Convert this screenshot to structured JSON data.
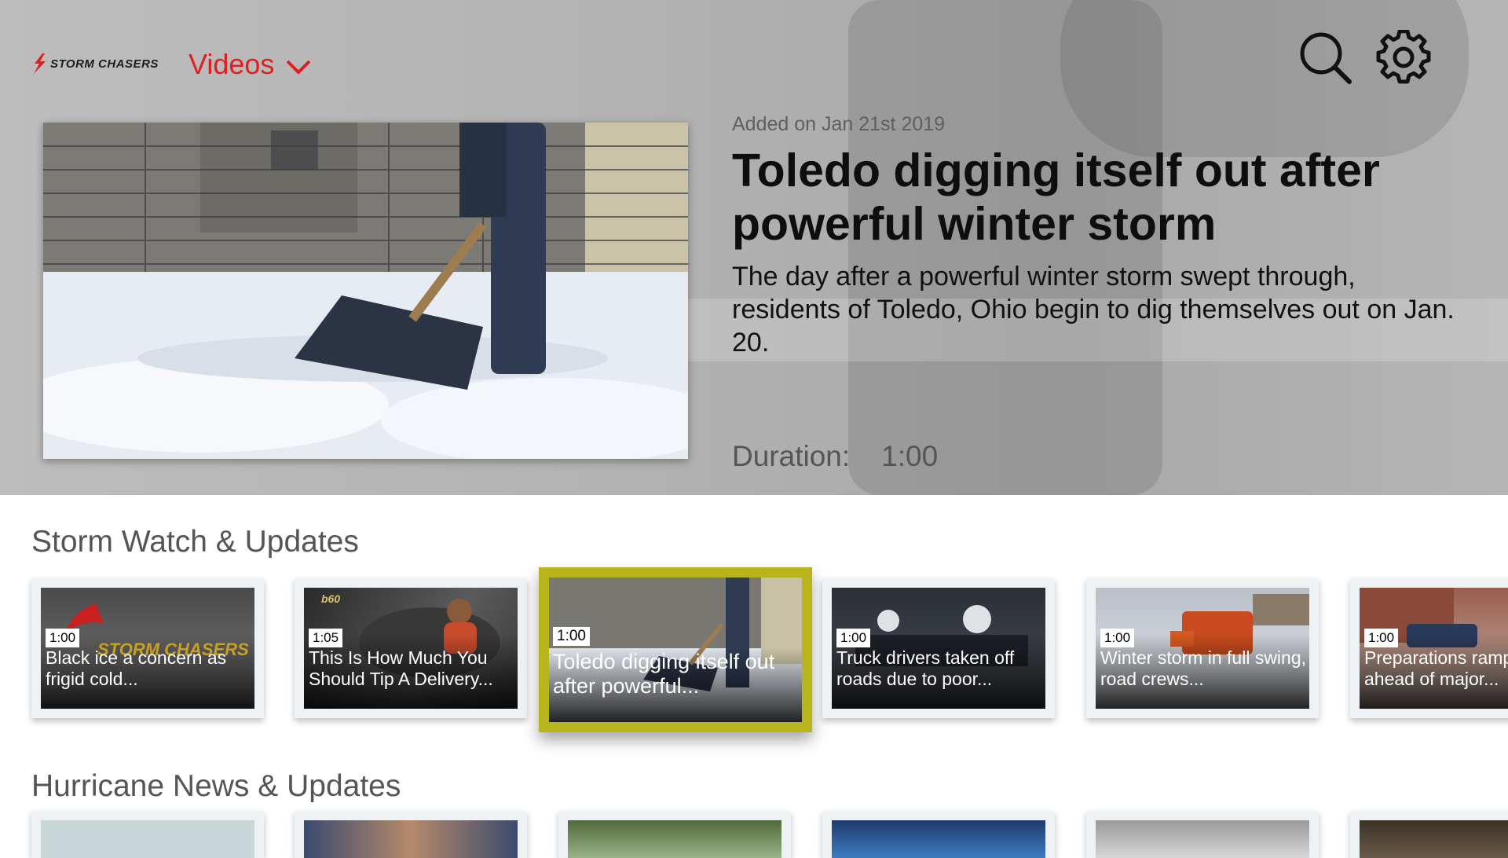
{
  "app": {
    "logo_text": "STORM CHASERS",
    "nav_label": "Videos",
    "accent": "#e02020",
    "focus_color": "#b8b51c"
  },
  "icons": {
    "search": "search-icon",
    "settings": "gear-icon",
    "menu_chevron": "chevron-down-icon"
  },
  "hero": {
    "added": "Added on Jan 21st 2019",
    "title": "Toledo digging itself out after powerful winter storm",
    "description": "The day after a powerful winter storm swept through, residents of Toledo, Ohio begin to dig themselves out on Jan. 20.",
    "duration_label": "Duration:",
    "duration_value": "1:00"
  },
  "rows": [
    {
      "title": "Storm Watch & Updates",
      "cards": [
        {
          "duration": "1:00",
          "title": "Black ice a concern as frigid cold...",
          "logo_text": "STORM CHASERS"
        },
        {
          "duration": "1:05",
          "title": "This Is How Much You Should Tip A Delivery...",
          "badge": "b60"
        },
        {
          "duration": "1:00",
          "title": "Toledo digging itself out after powerful..."
        },
        {
          "duration": "1:00",
          "title": "Truck drivers taken off roads due to poor..."
        },
        {
          "duration": "1:00",
          "title": "Winter storm in full swing, road crews..."
        },
        {
          "duration": "1:00",
          "title": "Preparations ramp up ahead of major..."
        }
      ]
    },
    {
      "title": "Hurricane News & Updates",
      "cards": [
        {},
        {},
        {},
        {},
        {},
        {}
      ]
    }
  ]
}
